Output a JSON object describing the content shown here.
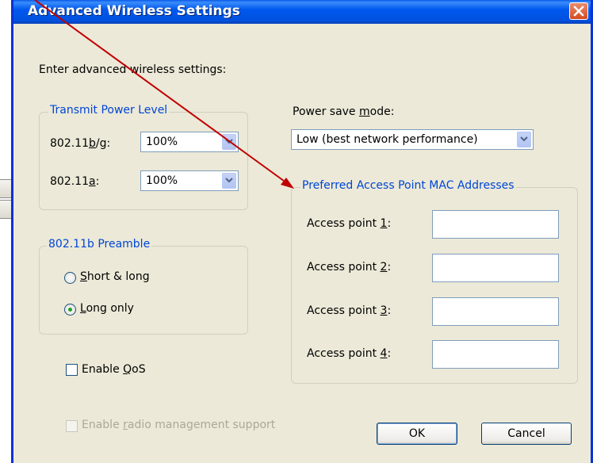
{
  "dialog": {
    "title": "Advanced Wireless Settings",
    "close_icon": "close-icon",
    "intro": "Enter advanced wireless settings:"
  },
  "transmit_power": {
    "legend": "Transmit Power Level",
    "bg_label_pre": "802.11",
    "bg_label_u": "b",
    "bg_label_post": "/g:",
    "bg_value": "100%",
    "a_label_pre": "802.11",
    "a_label_u": "a",
    "a_label_post": ":",
    "a_value": "100%"
  },
  "power_save": {
    "label_pre": "Power save ",
    "label_u": "m",
    "label_post": "ode:",
    "value": "Low (best network performance)"
  },
  "preamble": {
    "legend": "802.11b Preamble",
    "options": [
      {
        "label_u": "S",
        "label_post": "hort & long",
        "selected": false
      },
      {
        "label_u": "L",
        "label_post": "ong only",
        "selected": true
      }
    ]
  },
  "preferred_ap": {
    "legend": "Preferred Access Point MAC Addresses",
    "items": [
      {
        "label_pre": "Access point ",
        "label_u": "1",
        "label_post": ":",
        "value": ""
      },
      {
        "label_pre": "Access point ",
        "label_u": "2",
        "label_post": ":",
        "value": ""
      },
      {
        "label_pre": "Access point ",
        "label_u": "3",
        "label_post": ":",
        "value": ""
      },
      {
        "label_pre": "Access point ",
        "label_u": "4",
        "label_post": ":",
        "value": ""
      }
    ]
  },
  "qos": {
    "label_pre": "Enable ",
    "label_u": "Q",
    "label_post": "oS",
    "checked": false
  },
  "radio_mgmt": {
    "label_pre": "Enable ",
    "label_u": "r",
    "label_post": "adio management support",
    "checked": false,
    "enabled": false
  },
  "buttons": {
    "ok": "OK",
    "cancel": "Cancel"
  },
  "colors": {
    "title_bar": "#0058ee",
    "group_legend": "#0046d5",
    "annotation_arrow": "#c00000",
    "dialog_bg": "#ece9d8"
  }
}
